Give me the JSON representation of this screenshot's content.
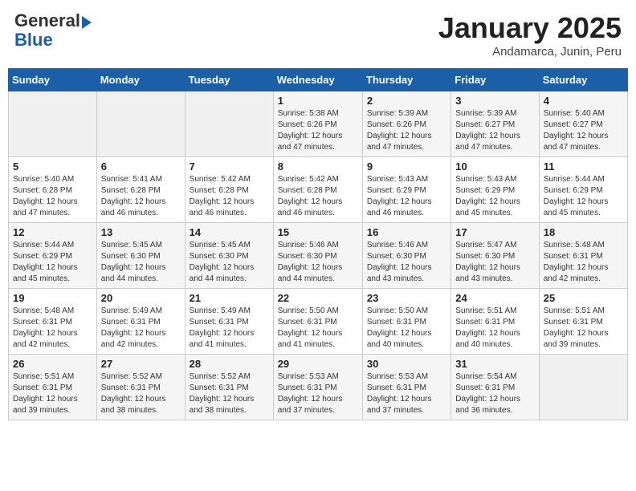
{
  "header": {
    "logo_general": "General",
    "logo_blue": "Blue",
    "month_title": "January 2025",
    "subtitle": "Andamarca, Junin, Peru"
  },
  "days_of_week": [
    "Sunday",
    "Monday",
    "Tuesday",
    "Wednesday",
    "Thursday",
    "Friday",
    "Saturday"
  ],
  "weeks": [
    [
      {
        "day": "",
        "info": ""
      },
      {
        "day": "",
        "info": ""
      },
      {
        "day": "",
        "info": ""
      },
      {
        "day": "1",
        "info": "Sunrise: 5:38 AM\nSunset: 6:26 PM\nDaylight: 12 hours\nand 47 minutes."
      },
      {
        "day": "2",
        "info": "Sunrise: 5:39 AM\nSunset: 6:26 PM\nDaylight: 12 hours\nand 47 minutes."
      },
      {
        "day": "3",
        "info": "Sunrise: 5:39 AM\nSunset: 6:27 PM\nDaylight: 12 hours\nand 47 minutes."
      },
      {
        "day": "4",
        "info": "Sunrise: 5:40 AM\nSunset: 6:27 PM\nDaylight: 12 hours\nand 47 minutes."
      }
    ],
    [
      {
        "day": "5",
        "info": "Sunrise: 5:40 AM\nSunset: 6:28 PM\nDaylight: 12 hours\nand 47 minutes."
      },
      {
        "day": "6",
        "info": "Sunrise: 5:41 AM\nSunset: 6:28 PM\nDaylight: 12 hours\nand 46 minutes."
      },
      {
        "day": "7",
        "info": "Sunrise: 5:42 AM\nSunset: 6:28 PM\nDaylight: 12 hours\nand 46 minutes."
      },
      {
        "day": "8",
        "info": "Sunrise: 5:42 AM\nSunset: 6:28 PM\nDaylight: 12 hours\nand 46 minutes."
      },
      {
        "day": "9",
        "info": "Sunrise: 5:43 AM\nSunset: 6:29 PM\nDaylight: 12 hours\nand 46 minutes."
      },
      {
        "day": "10",
        "info": "Sunrise: 5:43 AM\nSunset: 6:29 PM\nDaylight: 12 hours\nand 45 minutes."
      },
      {
        "day": "11",
        "info": "Sunrise: 5:44 AM\nSunset: 6:29 PM\nDaylight: 12 hours\nand 45 minutes."
      }
    ],
    [
      {
        "day": "12",
        "info": "Sunrise: 5:44 AM\nSunset: 6:29 PM\nDaylight: 12 hours\nand 45 minutes."
      },
      {
        "day": "13",
        "info": "Sunrise: 5:45 AM\nSunset: 6:30 PM\nDaylight: 12 hours\nand 44 minutes."
      },
      {
        "day": "14",
        "info": "Sunrise: 5:45 AM\nSunset: 6:30 PM\nDaylight: 12 hours\nand 44 minutes."
      },
      {
        "day": "15",
        "info": "Sunrise: 5:46 AM\nSunset: 6:30 PM\nDaylight: 12 hours\nand 44 minutes."
      },
      {
        "day": "16",
        "info": "Sunrise: 5:46 AM\nSunset: 6:30 PM\nDaylight: 12 hours\nand 43 minutes."
      },
      {
        "day": "17",
        "info": "Sunrise: 5:47 AM\nSunset: 6:30 PM\nDaylight: 12 hours\nand 43 minutes."
      },
      {
        "day": "18",
        "info": "Sunrise: 5:48 AM\nSunset: 6:31 PM\nDaylight: 12 hours\nand 42 minutes."
      }
    ],
    [
      {
        "day": "19",
        "info": "Sunrise: 5:48 AM\nSunset: 6:31 PM\nDaylight: 12 hours\nand 42 minutes."
      },
      {
        "day": "20",
        "info": "Sunrise: 5:49 AM\nSunset: 6:31 PM\nDaylight: 12 hours\nand 42 minutes."
      },
      {
        "day": "21",
        "info": "Sunrise: 5:49 AM\nSunset: 6:31 PM\nDaylight: 12 hours\nand 41 minutes."
      },
      {
        "day": "22",
        "info": "Sunrise: 5:50 AM\nSunset: 6:31 PM\nDaylight: 12 hours\nand 41 minutes."
      },
      {
        "day": "23",
        "info": "Sunrise: 5:50 AM\nSunset: 6:31 PM\nDaylight: 12 hours\nand 40 minutes."
      },
      {
        "day": "24",
        "info": "Sunrise: 5:51 AM\nSunset: 6:31 PM\nDaylight: 12 hours\nand 40 minutes."
      },
      {
        "day": "25",
        "info": "Sunrise: 5:51 AM\nSunset: 6:31 PM\nDaylight: 12 hours\nand 39 minutes."
      }
    ],
    [
      {
        "day": "26",
        "info": "Sunrise: 5:51 AM\nSunset: 6:31 PM\nDaylight: 12 hours\nand 39 minutes."
      },
      {
        "day": "27",
        "info": "Sunrise: 5:52 AM\nSunset: 6:31 PM\nDaylight: 12 hours\nand 38 minutes."
      },
      {
        "day": "28",
        "info": "Sunrise: 5:52 AM\nSunset: 6:31 PM\nDaylight: 12 hours\nand 38 minutes."
      },
      {
        "day": "29",
        "info": "Sunrise: 5:53 AM\nSunset: 6:31 PM\nDaylight: 12 hours\nand 37 minutes."
      },
      {
        "day": "30",
        "info": "Sunrise: 5:53 AM\nSunset: 6:31 PM\nDaylight: 12 hours\nand 37 minutes."
      },
      {
        "day": "31",
        "info": "Sunrise: 5:54 AM\nSunset: 6:31 PM\nDaylight: 12 hours\nand 36 minutes."
      },
      {
        "day": "",
        "info": ""
      }
    ]
  ]
}
